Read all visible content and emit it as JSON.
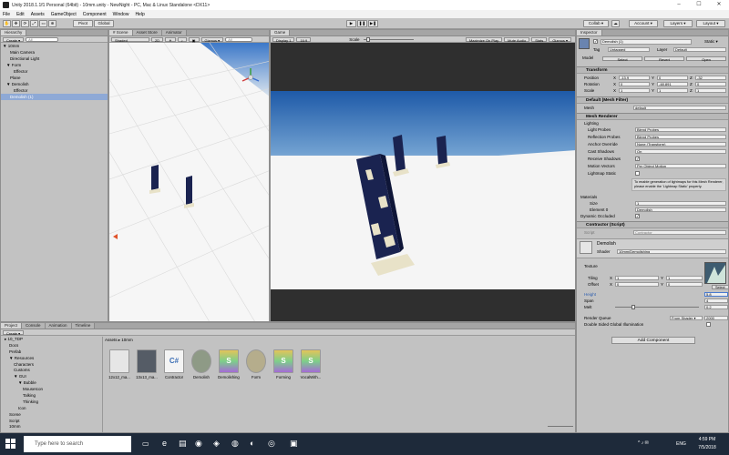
{
  "window": {
    "title": "Unity 2018.1.1f1 Personal (64bit) - 10mm.unity - NewNight - PC, Mac & Linux Standalone <DX11>",
    "controls": [
      "–",
      "☐",
      "✕"
    ]
  },
  "menu": [
    "File",
    "Edit",
    "Assets",
    "GameObject",
    "Component",
    "Window",
    "Help"
  ],
  "toolbar": {
    "pivot": "Pivot",
    "global": "Global",
    "collab": "Collab ▾",
    "account": "Account ▾",
    "layers": "Layers ▾",
    "layout": "Layout ▾"
  },
  "hierarchy": {
    "tab": "Hierarchy",
    "create": "Create ▾",
    "search_placeholder": "All",
    "items": [
      {
        "label": "▼ 10mm",
        "indent": 0,
        "selected": false
      },
      {
        "label": "Main Camera",
        "indent": 2,
        "selected": false
      },
      {
        "label": "Directional Light",
        "indent": 2,
        "selected": false
      },
      {
        "label": "▼ Form",
        "indent": 1,
        "selected": false
      },
      {
        "label": "Effector",
        "indent": 3,
        "selected": false
      },
      {
        "label": "Plane",
        "indent": 2,
        "selected": false
      },
      {
        "label": "▼ Demolish",
        "indent": 1,
        "selected": false
      },
      {
        "label": "Effector",
        "indent": 3,
        "selected": false
      },
      {
        "label": "Demolish (1)",
        "indent": 2,
        "selected": true
      }
    ]
  },
  "scene": {
    "tabs": [
      "# Scene",
      "Asset Store",
      "Animator"
    ],
    "shading": "Shaded",
    "mode": "2D",
    "gizmos": "Gizmos ▾",
    "search_placeholder": "All"
  },
  "game": {
    "tab": "Game",
    "display": "Display 1",
    "aspect": "16:9",
    "scale_label": "Scale",
    "maximize": "Maximize On Play",
    "mute": "Mute Audio",
    "stats": "Stats",
    "gizmos": "Gizmos ▾"
  },
  "inspector": {
    "tab": "Inspector",
    "object_name": "Demolish (1)",
    "static_label": "Static ▾",
    "tag_label": "Tag",
    "tag_value": "Untagged",
    "layer_label": "Layer",
    "layer_value": "Default",
    "model_label": "Model",
    "model_buttons": [
      "Select",
      "Revert",
      "Open"
    ],
    "transform": {
      "title": "Transform",
      "rows": [
        {
          "label": "Position",
          "x": "-13.9",
          "y": "0",
          "z": "-32"
        },
        {
          "label": "Rotation",
          "x": "0",
          "y": "-48.891",
          "z": "0"
        },
        {
          "label": "Scale",
          "x": "1",
          "y": "1",
          "z": "1"
        }
      ]
    },
    "mesh_filter": {
      "title": "Default (Mesh Filter)",
      "mesh_label": "Mesh",
      "mesh_value": "default"
    },
    "mesh_renderer": {
      "title": "Mesh Renderer",
      "lighting": "Lighting",
      "rows": [
        {
          "label": "Light Probes",
          "value": "Blend Probes"
        },
        {
          "label": "Reflection Probes",
          "value": "Blend Probes"
        },
        {
          "label": "Anchor Override",
          "value": "None (Transform)"
        },
        {
          "label": "Cast Shadows",
          "value": "On"
        },
        {
          "label": "Receive Shadows",
          "value": "✓"
        },
        {
          "label": "Motion Vectors",
          "value": "Per Object Motion"
        },
        {
          "label": "Lightmap Static",
          "value": ""
        }
      ],
      "note": "To enable generation of lightmaps for this Mesh Renderer, please enable the 'Lightmap Static' property.",
      "materials": "Materials",
      "size_label": "Size",
      "size_value": "1",
      "element_label": "Element 0",
      "element_value": "Demolish",
      "dynamic_occluded": "Dynamic Occluded"
    },
    "contractor": {
      "title": "Contractor (Script)",
      "script_label": "Script",
      "script_value": "Contractor"
    },
    "material": {
      "name": "Demolish",
      "shader_label": "Shader",
      "shader_value": "10mm/Demolishing",
      "texture_label": "Texture",
      "tiling_label": "Tiling",
      "offset_label": "Offset",
      "tiling_x": "1",
      "tiling_y": "1",
      "offset_x": "0",
      "offset_y": "0",
      "select": "Select",
      "height_label": "Height",
      "height_value": "5.8",
      "span_label": "Span",
      "span_value": "4",
      "melt_label": "Melt",
      "melt_value": "0.2",
      "melt_fraction": 0.2,
      "render_queue_label": "Render Queue",
      "render_queue_mode": "From Shader ▾",
      "render_queue_value": "2000",
      "double_sided": "Double Sided Global Illumination"
    },
    "add_component": "Add Component"
  },
  "project": {
    "tabs": [
      "Project",
      "Console",
      "Animation",
      "Timeline"
    ],
    "create": "Create ▾",
    "breadcrumb": "Assets ▸ 10mm",
    "tree": [
      {
        "label": "▸ 10_TDP",
        "indent": 0
      },
      {
        "label": "Docs",
        "indent": 1
      },
      {
        "label": "Prefab",
        "indent": 1
      },
      {
        "label": "▼ Resources",
        "indent": 1
      },
      {
        "label": "Characters",
        "indent": 2
      },
      {
        "label": "Customs",
        "indent": 2
      },
      {
        "label": "▼ GUI",
        "indent": 2
      },
      {
        "label": "▼ Bubble",
        "indent": 3
      },
      {
        "label": "MouseIcon",
        "indent": 4
      },
      {
        "label": "Talking",
        "indent": 4
      },
      {
        "label": "Thinking",
        "indent": 4
      },
      {
        "label": "Icon",
        "indent": 3
      },
      {
        "label": "Scene",
        "indent": 1
      },
      {
        "label": "Script",
        "indent": 1
      },
      {
        "label": "10mm",
        "indent": 1
      }
    ],
    "assets": [
      {
        "label": "12x12_ma...",
        "kind": "doc",
        "color": "#e6e6e6"
      },
      {
        "label": "13x13_ma...",
        "kind": "model",
        "color": "#555c66"
      },
      {
        "label": "Contractor",
        "kind": "cs",
        "color": "#f4f4f4"
      },
      {
        "label": "Demolish",
        "kind": "mat",
        "color": "#8e9a86"
      },
      {
        "label": "Demolishing",
        "kind": "shader",
        "color": "#c468c8"
      },
      {
        "label": "Form",
        "kind": "mat",
        "color": "#b5ad8c"
      },
      {
        "label": "Forming",
        "kind": "shader",
        "color": "#c468c8"
      },
      {
        "label": "VocalWith...",
        "kind": "shader",
        "color": "#c468c8"
      }
    ]
  },
  "taskbar": {
    "search_placeholder": "Type here to search",
    "lang": "ENG",
    "time": "4:59 PM",
    "date": "7/5/2018"
  },
  "colors": {
    "editor_bg": "#c2c2c2",
    "sky_top": "#1e5aa8",
    "ground": "#f2f2f2",
    "building_dark": "#1a2350",
    "building_light": "#e8e2c8",
    "selection": "#8ea9d6",
    "taskbar": "#1e2a3a"
  }
}
